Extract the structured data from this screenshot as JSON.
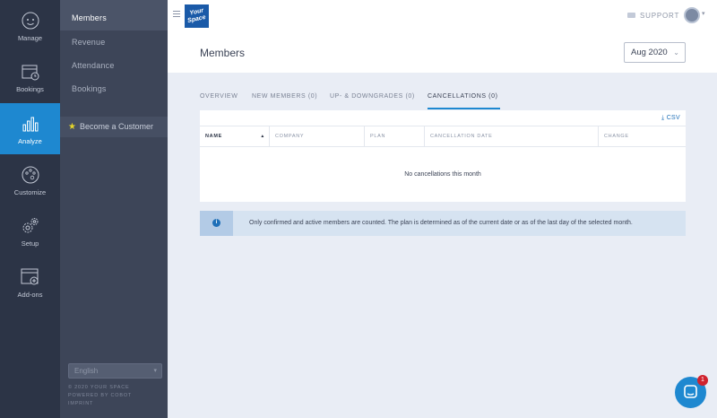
{
  "rail": [
    {
      "label": "Manage",
      "icon": "face-icon"
    },
    {
      "label": "Bookings",
      "icon": "calendar-icon"
    },
    {
      "label": "Analyze",
      "icon": "bar-chart-icon",
      "active": true
    },
    {
      "label": "Customize",
      "icon": "palette-icon"
    },
    {
      "label": "Setup",
      "icon": "gears-icon"
    },
    {
      "label": "Add-ons",
      "icon": "window-plus-icon"
    }
  ],
  "subnav": {
    "items": [
      "Members",
      "Revenue",
      "Attendance",
      "Bookings"
    ],
    "become_customer": "Become a Customer",
    "language": "English",
    "footer": [
      "© 2020 YOUR SPACE",
      "POWERED BY COBOT",
      "IMPRINT"
    ]
  },
  "topbar": {
    "logo_line1": "Your",
    "logo_line2": "Space",
    "support": "SUPPORT"
  },
  "page": {
    "title": "Members",
    "month": "Aug 2020"
  },
  "tabs": [
    "OVERVIEW",
    "NEW MEMBERS (0)",
    "UP- & DOWNGRADES (0)",
    "CANCELLATIONS (0)"
  ],
  "table": {
    "csv": "CSV",
    "columns": [
      "NAME",
      "COMPANY",
      "PLAN",
      "CANCELLATION DATE",
      "CHANGE"
    ],
    "empty": "No cancellations this month"
  },
  "info": {
    "text": "Only confirmed and active members are counted. The plan is determined as of the current date or as of the last day of the selected month."
  },
  "chat": {
    "badge": "1"
  },
  "colors": {
    "accent": "#1e88d0",
    "rail": "#2c3446",
    "subnav": "#3d4558"
  }
}
